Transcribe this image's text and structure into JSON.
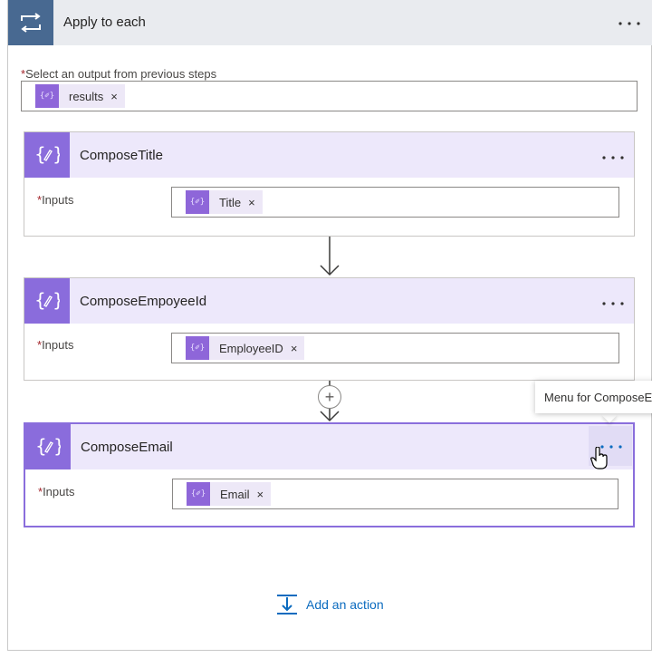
{
  "scope": {
    "title": "Apply to each",
    "menu_icon": "more-dots-icon",
    "icon": "loop-icon",
    "output_label": "Select an output from previous steps",
    "required_mark": "*",
    "output_token": "results"
  },
  "actions": [
    {
      "title": "ComposeTitle",
      "input_label": "Inputs",
      "token": "Title",
      "icon": "compose-icon"
    },
    {
      "title": "ComposeEmpoyeeId",
      "input_label": "Inputs",
      "token": "EmployeeID",
      "icon": "compose-icon"
    },
    {
      "title": "ComposeEmail",
      "input_label": "Inputs",
      "token": "Email",
      "icon": "compose-icon"
    }
  ],
  "tooltip": "Menu for ComposeEmail",
  "token_glyph": "{✐}",
  "add_action_label": "Add an action",
  "remove_glyph": "×",
  "insert_glyph": "+",
  "colors": {
    "scope_header": "#e9ebef",
    "scope_icon": "#486991",
    "action_header": "#ede8fb",
    "action_icon": "#8a6cdc",
    "link": "#0b6bbf"
  }
}
